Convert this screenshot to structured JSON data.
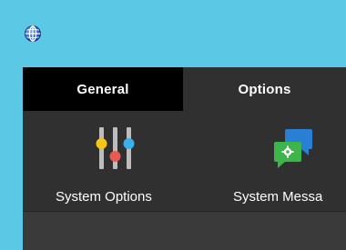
{
  "window": {
    "app_icon": "globe-icon"
  },
  "tabs": [
    {
      "label": "General",
      "selected": true
    },
    {
      "label": "Options",
      "selected": false
    }
  ],
  "ribbon": {
    "items": [
      {
        "label": "System Options",
        "icon": "sliders-icon"
      },
      {
        "label": "System Messa",
        "icon": "message-settings-icon"
      }
    ]
  },
  "colors": {
    "title_bar": "#5bc8e6",
    "tab_strip": "#000000",
    "ribbon_bg": "#303030",
    "slider_yellow": "#f5c518",
    "slider_red": "#e85a4f",
    "slider_blue": "#3bb0e8",
    "message_blue": "#2a7fd4",
    "message_green": "#3cb54a"
  }
}
